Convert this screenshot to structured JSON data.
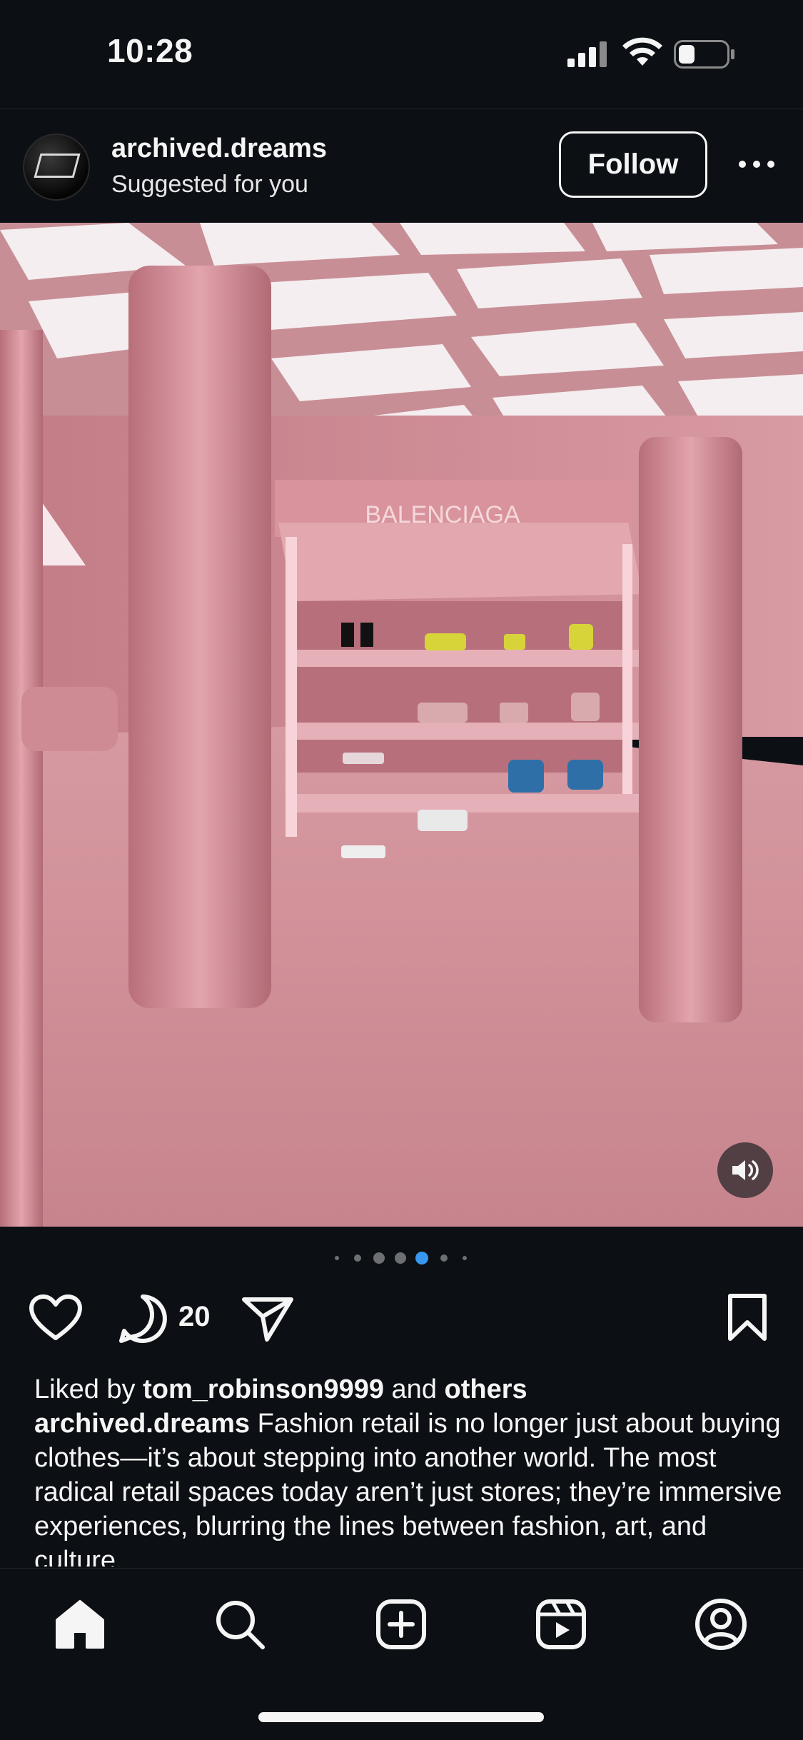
{
  "status_bar": {
    "time": "10:28"
  },
  "post_header": {
    "username": "archived.dreams",
    "subtitle": "Suggested for you",
    "follow_label": "Follow"
  },
  "photo": {
    "sign_text": "BALENCIAGA"
  },
  "carousel": {
    "count": 7,
    "active_index": 4
  },
  "actions": {
    "comment_count": "20"
  },
  "likes": {
    "prefix": "Liked by",
    "user": "tom_robinson9999",
    "joiner": "and",
    "others": "others"
  },
  "caption": {
    "author": "archived.dreams",
    "text": "Fashion retail is no longer just about buying clothes—it’s about stepping into another world. The most radical retail spaces today aren’t just stores; they’re immersive experiences, blurring the lines between fashion, art, and culture."
  },
  "colors": {
    "accent": "#3897f0",
    "background": "#0c1014",
    "fur_pink": "#d98a94"
  }
}
